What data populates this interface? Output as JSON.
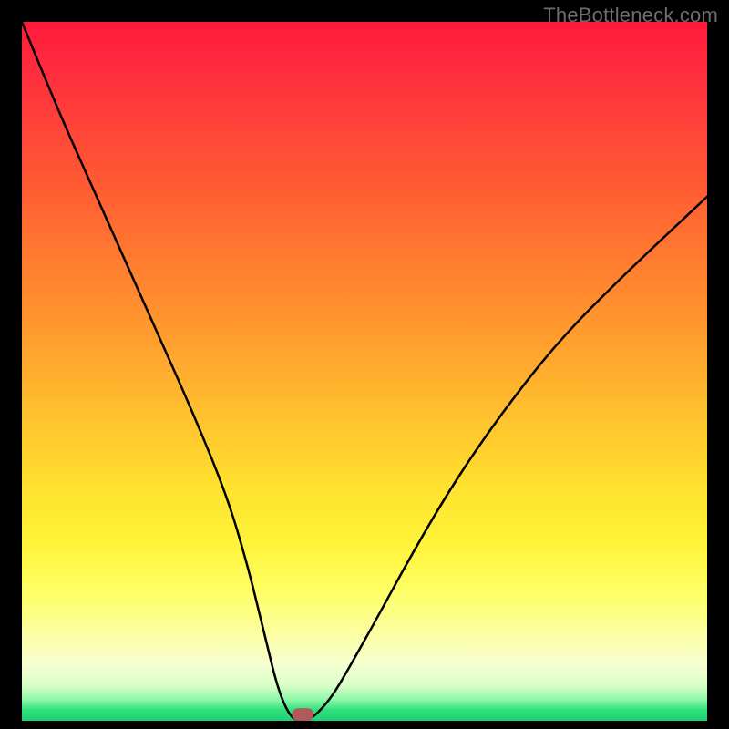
{
  "watermark": {
    "text": "TheBottleneck.com"
  },
  "chart_data": {
    "type": "line",
    "title": "",
    "xlabel": "",
    "ylabel": "",
    "xlim": [
      0,
      100
    ],
    "ylim": [
      0,
      100
    ],
    "series": [
      {
        "name": "curve",
        "x": [
          0,
          5,
          10,
          15,
          20,
          25,
          30,
          33,
          35,
          36,
          37,
          38,
          39,
          40,
          42,
          45,
          48,
          52,
          57,
          63,
          70,
          78,
          87,
          100
        ],
        "values": [
          100,
          88,
          77,
          66,
          55,
          44,
          32,
          22,
          14,
          10,
          6,
          3,
          1,
          0,
          0,
          3,
          8,
          15,
          24,
          34,
          44,
          54,
          63,
          75
        ]
      }
    ],
    "marker": {
      "x": 41,
      "y": 0.5
    },
    "gradient_stops_pct": [
      0,
      7,
      22,
      40,
      55,
      67,
      75,
      82,
      88,
      92,
      95,
      97,
      98.5,
      100
    ],
    "gradient_colors": [
      "#ff1a3a",
      "#ff2d3f",
      "#ff5733",
      "#ff8d2e",
      "#ffbd2e",
      "#ffe22e",
      "#fff43a",
      "#feff6a",
      "#fbffa6",
      "#f6ffd1",
      "#d8ffc8",
      "#8cf7a7",
      "#2fe07c",
      "#1fcf76"
    ]
  }
}
